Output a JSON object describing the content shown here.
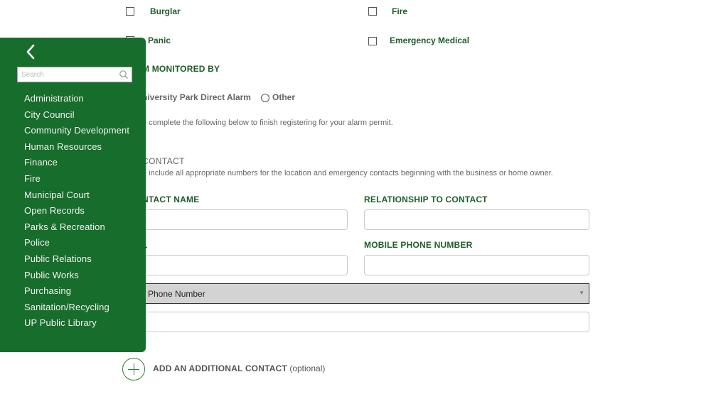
{
  "alarm_types": {
    "burglar": "Burglar",
    "fire": "Fire",
    "panic": "Panic",
    "emergency_medical": "Emergency Medical"
  },
  "monitored_by": {
    "title": "M MONITORED BY",
    "option_direct": "niversity Park Direct Alarm",
    "option_other": "Other"
  },
  "instructions": "e complete the following below to finish registering for your alarm permit.",
  "contact": {
    "title": "CONTACT",
    "note": "e include all appropriate numbers for the location and emergency contacts beginning with the business or home owner.",
    "contact_name_label": "NTACT NAME",
    "relationship_label": "RELATIONSHIP TO CONTACT",
    "email_label": "L",
    "mobile_label": "MOBILE PHONE NUMBER",
    "phone_type_selected": "Phone Number"
  },
  "add_contact": {
    "label": "ADD AN ADDITIONAL CONTACT",
    "optional": "(optional)"
  },
  "sidebar": {
    "search_placeholder": "Search",
    "items": [
      "Administration",
      "City Council",
      "Community Development",
      "Human Resources",
      "Finance",
      "Fire",
      "Municipal Court",
      "Open Records",
      "Parks & Recreation",
      "Police",
      "Public Relations",
      "Public Works",
      "Purchasing",
      "Sanitation/Recycling",
      "UP Public Library"
    ]
  },
  "colors": {
    "sidebar_bg": "#176d2c",
    "label_green": "#1f5c2a",
    "accent_green": "#2e7d3a"
  }
}
